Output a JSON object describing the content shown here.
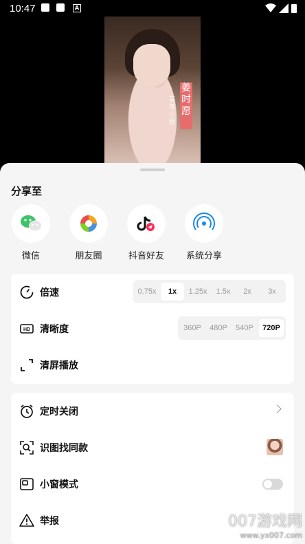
{
  "status_bar": {
    "time": "10:47"
  },
  "video": {
    "title_chars": [
      "姜",
      "时",
      "愿"
    ],
    "subtitle": "芸茶小姐"
  },
  "share": {
    "title": "分享至",
    "items": [
      {
        "label": "微信",
        "icon": "wechat-icon"
      },
      {
        "label": "朋友圈",
        "icon": "moments-icon"
      },
      {
        "label": "抖音好友",
        "icon": "douyin-icon"
      },
      {
        "label": "系统分享",
        "icon": "airdrop-icon"
      }
    ]
  },
  "playback": {
    "speed": {
      "label": "倍速",
      "options": [
        "0.75x",
        "1x",
        "1.25x",
        "1.5x",
        "2x",
        "3x"
      ],
      "selected": "1x"
    },
    "quality": {
      "label": "清晰度",
      "options": [
        "360P",
        "480P",
        "540P",
        "720P"
      ],
      "selected": "720P"
    },
    "clear_screen": {
      "label": "清屏播放"
    }
  },
  "tools": {
    "timer": {
      "label": "定时关闭"
    },
    "image_search": {
      "label": "识图找同款"
    },
    "mini_window": {
      "label": "小窗模式",
      "enabled": false
    },
    "report": {
      "label": "举报"
    }
  },
  "watermark": {
    "line1": "007游戏网",
    "line2": "www.yx007.com"
  },
  "colors": {
    "sheet_bg": "#f5f5f5",
    "card_bg": "#ffffff",
    "accent_red": "#e76d6d"
  }
}
